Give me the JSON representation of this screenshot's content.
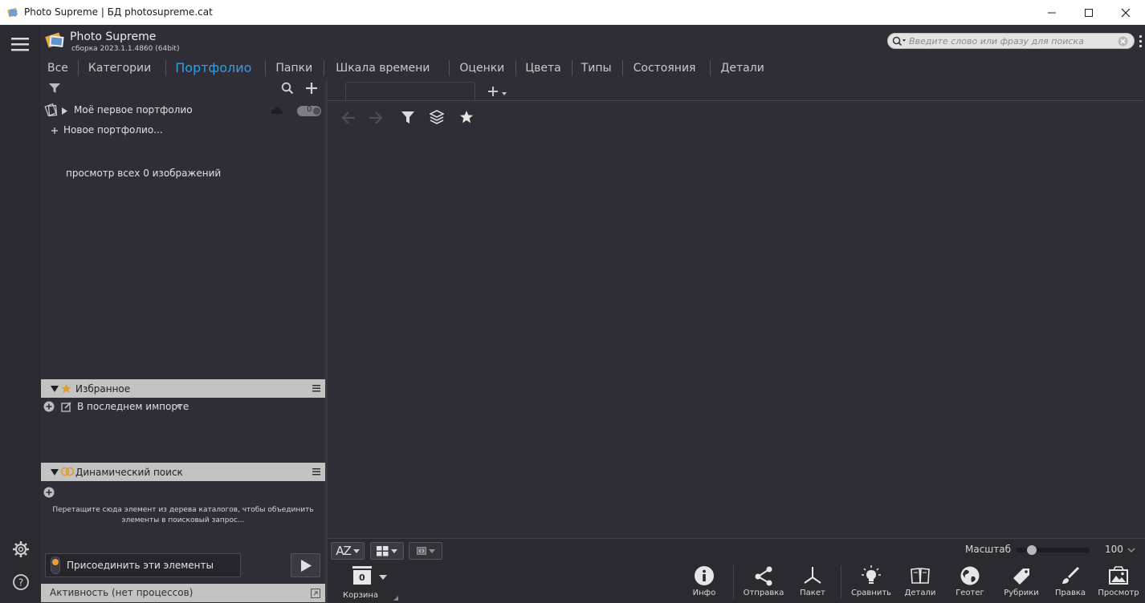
{
  "window": {
    "title": "Photo Supreme | БД photosupreme.cat"
  },
  "brand": {
    "name": "Photo Supreme",
    "build": "сборка 2023.1.1.4860 (64bit)"
  },
  "search": {
    "placeholder": "Введите слово или фразу для поиска"
  },
  "tabs": [
    {
      "label": "Все"
    },
    {
      "label": "Категории"
    },
    {
      "label": "Портфолио"
    },
    {
      "label": "Папки"
    },
    {
      "label": "Шкала времени"
    },
    {
      "label": "Оценки"
    },
    {
      "label": "Цвета"
    },
    {
      "label": "Типы"
    },
    {
      "label": "Состояния"
    },
    {
      "label": "Детали"
    }
  ],
  "tree": {
    "portfolio_item": "Моё первое портфолио",
    "portfolio_count": "0",
    "new_portfolio": "Новое портфолио...",
    "view_all": "просмотр всех 0 изображений"
  },
  "favorites": {
    "header": "Избранное",
    "item": "В последнем импорте"
  },
  "dynamic_search": {
    "header": "Динамический поиск",
    "hint_line1": "Перетащите сюда элемент из дерева каталогов, чтобы объединить",
    "hint_line2": "элементы в поисковый запрос..."
  },
  "join_button": {
    "label": "Присоединить эти элементы"
  },
  "activity": {
    "label": "Активность (нет процессов)"
  },
  "viewbar": {
    "scale_label": "Масштаб",
    "scale_value": "100",
    "sort_label": "AZ",
    "scale_fraction": 0.0
  },
  "basket": {
    "count": "0",
    "label": "Корзина"
  },
  "actions": [
    {
      "label": "Инфо"
    },
    {
      "label": "Отправка"
    },
    {
      "label": "Пакет"
    },
    {
      "label": "Сравнить"
    },
    {
      "label": "Детали"
    },
    {
      "label": "Геотег"
    },
    {
      "label": "Рубрики"
    },
    {
      "label": "Правка"
    },
    {
      "label": "Просмотр"
    }
  ],
  "colors": {
    "accent": "#2f9fe6",
    "background": "#2f2e36",
    "section_header": "#c3c3c3"
  }
}
